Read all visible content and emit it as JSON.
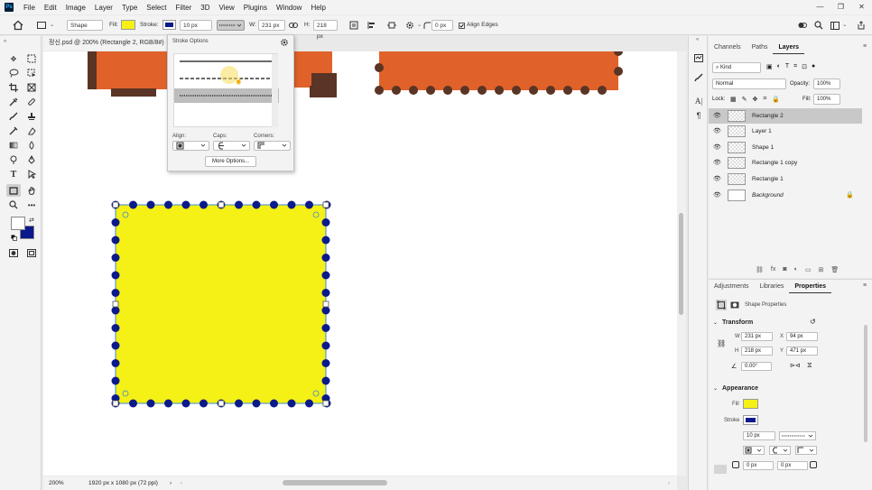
{
  "app": {
    "logo": "Ps"
  },
  "menu": [
    "File",
    "Edit",
    "Image",
    "Layer",
    "Type",
    "Select",
    "Filter",
    "3D",
    "View",
    "Plugins",
    "Window",
    "Help"
  ],
  "window_buttons": [
    "—",
    "❐",
    "✕"
  ],
  "options_bar": {
    "mode": "Shape",
    "fill_label": "Fill:",
    "stroke_label": "Stroke:",
    "stroke_width": "10 px",
    "w_label": "W:",
    "w_value": "231 px",
    "h_label": "H:",
    "h_value": "218 px",
    "radius_value": "0 px",
    "align_edges": "Align Edges",
    "fill_color": "#f5f016",
    "stroke_color": "#0a1a8a"
  },
  "document": {
    "tab_title": "정신.psd @ 200% (Rectangle 2, RGB/8#)",
    "tab_close": "×"
  },
  "stroke_popup": {
    "title": "Stroke Options",
    "align_label": "Align:",
    "caps_label": "Caps:",
    "corners_label": "Corners:",
    "more_button": "More Options..."
  },
  "status": {
    "zoom": "200%",
    "doc_info": "1920 px x 1080 px (72 ppi)"
  },
  "layers_panel": {
    "tabs": [
      "Channels",
      "Paths",
      "Layers"
    ],
    "active_tab": "Layers",
    "kind_filter": "Kind",
    "blend_mode": "Normal",
    "opacity_label": "Opacity:",
    "opacity_value": "100%",
    "lock_label": "Lock:",
    "fill_label": "Fill:",
    "fill_value": "100%",
    "layers": [
      {
        "name": "Rectangle 2",
        "selected": true
      },
      {
        "name": "Layer 1",
        "selected": false
      },
      {
        "name": "Shape 1",
        "selected": false
      },
      {
        "name": "Rectangle 1 copy",
        "selected": false
      },
      {
        "name": "Rectangle 1",
        "selected": false
      },
      {
        "name": "Background",
        "selected": false
      }
    ]
  },
  "properties_panel": {
    "tabs": [
      "Adjustments",
      "Libraries",
      "Properties"
    ],
    "active_tab": "Properties",
    "kind_title": "Shape Properties",
    "transform_title": "Transform",
    "w_label": "W",
    "w_value": "231 px",
    "x_label": "X",
    "x_value": "94 px",
    "h_label": "H",
    "h_value": "218 px",
    "y_label": "Y",
    "y_value": "471 px",
    "angle_value": "0.00°",
    "appearance_title": "Appearance",
    "fill_label": "Fill",
    "stroke_label": "Stroke",
    "stroke_width": "10 px",
    "radius_1": "0 px",
    "radius_2": "0 px"
  }
}
